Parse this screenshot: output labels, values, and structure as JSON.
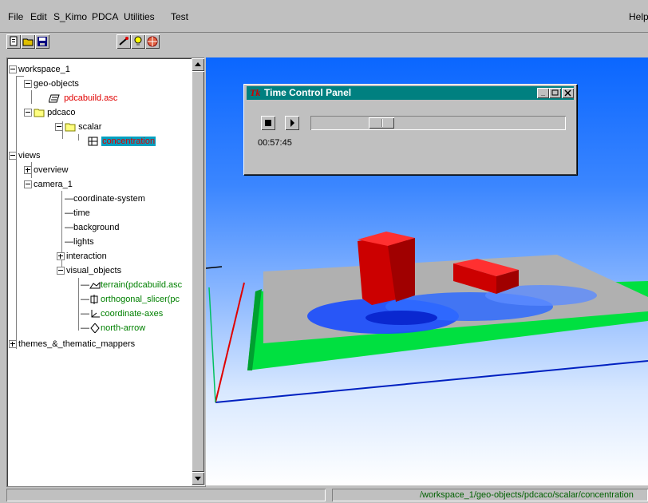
{
  "menu": [
    "File",
    "Edit",
    "S_Kimo",
    "PDCA",
    "Utilities",
    "Test"
  ],
  "menu_help": "Help",
  "toolbar_icons": [
    "new-file-icon",
    "open-folder-icon",
    "save-icon",
    "wand-icon",
    "lightbulb-icon",
    "globe-icon"
  ],
  "tree": {
    "workspace": "workspace_1",
    "geo_objects": "geo-objects",
    "pdcabuild": "pdcabuild.asc",
    "pdcaco": "pdcaco",
    "scalar": "scalar",
    "concentration": "concentration",
    "views": "views",
    "overview": "overview",
    "camera": "camera_1",
    "coordinate_system": "coordinate-system",
    "time": "time",
    "background": "background",
    "lights": "lights",
    "interaction": "interaction",
    "visual_objects": "visual_objects",
    "terrain": "terrain(pdcabuild.asc",
    "slicer": "orthogonal_slicer(pc",
    "axes": "coordinate-axes",
    "north_arrow": "north-arrow",
    "themes": "themes_&_thematic_mappers"
  },
  "time_panel": {
    "title": "Time Control Panel",
    "time": "00:57:45",
    "progress": 0.25
  },
  "status": {
    "left": "",
    "right": "/workspace_1/geo-objects/pdcaco/scalar/concentration"
  },
  "colors": {
    "titlebar": "#008080",
    "selection": "#00a0c0",
    "sky_top": "#0a66ff"
  }
}
